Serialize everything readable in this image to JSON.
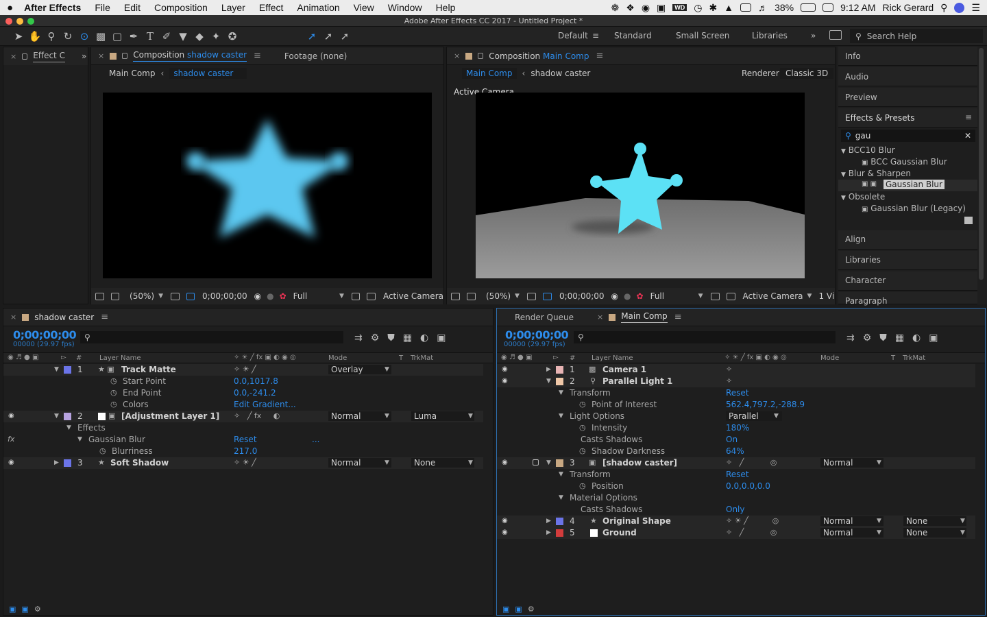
{
  "menubar": {
    "app": "After Effects",
    "items": [
      "File",
      "Edit",
      "Composition",
      "Layer",
      "Effect",
      "Animation",
      "View",
      "Window",
      "Help"
    ],
    "wd_badge": "WD",
    "battery": "38%",
    "time": "9:12 AM",
    "user": "Rick Gerard"
  },
  "window": {
    "title": "Adobe After Effects CC 2017 - Untitled Project *"
  },
  "workspaces": {
    "default": "Default",
    "standard": "Standard",
    "small_screen": "Small Screen",
    "libraries": "Libraries",
    "more": "»",
    "search_placeholder": "Search Help"
  },
  "effect_controls": {
    "tab": "Effect C",
    "more": "»"
  },
  "comp_viewer_left": {
    "tab_prefix": "Composition ",
    "tab_name": "shadow caster",
    "footage_tab": "Footage (none)",
    "breadcrumb": [
      "Main Comp",
      "shadow caster"
    ],
    "zoom": "(50%)",
    "timecode": "0;00;00;00",
    "resolution": "Full",
    "view": "Active Camera"
  },
  "comp_viewer_right": {
    "tab_prefix": "Composition ",
    "tab_name": "Main Comp",
    "breadcrumb": [
      "Main Comp",
      "shadow caster"
    ],
    "renderer_label": "Renderer:",
    "renderer_value": "Classic 3D",
    "canvas_label": "Active Camera",
    "zoom": "(50%)",
    "timecode": "0;00;00;00",
    "resolution": "Full",
    "view": "Active Camera",
    "views_count": "1 Vi"
  },
  "right_panels": {
    "info": "Info",
    "audio": "Audio",
    "preview": "Preview",
    "effects_presets": "Effects & Presets",
    "search_value": "gau",
    "tree": [
      {
        "type": "folder",
        "label": "BCC10 Blur"
      },
      {
        "type": "effect",
        "label": "BCC Gaussian Blur"
      },
      {
        "type": "folder",
        "label": "Blur & Sharpen"
      },
      {
        "type": "effect",
        "label": "Gaussian Blur",
        "selected": true
      },
      {
        "type": "folder",
        "label": "Obsolete"
      },
      {
        "type": "effect",
        "label": "Gaussian Blur (Legacy)"
      }
    ],
    "align": "Align",
    "libraries": "Libraries",
    "character": "Character",
    "paragraph": "Paragraph"
  },
  "timeline_left": {
    "tab": "shadow caster",
    "timecode": "0;00;00;00",
    "fps": "00000 (29.97 fps)",
    "col_num": "#",
    "col_layer_name": "Layer Name",
    "col_mode": "Mode",
    "col_t": "T",
    "col_trkmat": "TrkMat",
    "rows": [
      {
        "kind": "layer",
        "num": "1",
        "name": "Track Matte",
        "mode": "Overlay",
        "color": "#6b74e8"
      },
      {
        "kind": "prop",
        "name": "Start Point",
        "value": "0.0,1017.8"
      },
      {
        "kind": "prop",
        "name": "End Point",
        "value": "0.0,-241.2"
      },
      {
        "kind": "prop",
        "name": "Colors",
        "value": "Edit Gradient..."
      },
      {
        "kind": "layer",
        "num": "2",
        "name": "[Adjustment Layer 1]",
        "mode": "Normal",
        "trkmat": "Luma",
        "color": "#b7a3e0"
      },
      {
        "kind": "group",
        "name": "Effects"
      },
      {
        "kind": "fx",
        "name": "Gaussian Blur",
        "value": "Reset",
        "extra": "..."
      },
      {
        "kind": "prop",
        "name": "Blurriness",
        "value": "217.0"
      },
      {
        "kind": "layer",
        "num": "3",
        "name": "Soft Shadow",
        "mode": "Normal",
        "trkmat": "None",
        "color": "#6b74e8"
      }
    ]
  },
  "timeline_right": {
    "render_queue_tab": "Render Queue",
    "tab": "Main Comp",
    "timecode": "0;00;00;00",
    "fps": "00000 (29.97 fps)",
    "col_num": "#",
    "col_layer_name": "Layer Name",
    "col_mode": "Mode",
    "col_t": "T",
    "col_trkmat": "TrkMat",
    "rows": [
      {
        "kind": "layer",
        "num": "1",
        "name": "Camera 1",
        "color": "#e8b4b4"
      },
      {
        "kind": "layer",
        "num": "2",
        "name": "Parallel Light 1",
        "color": "#f0c8a8"
      },
      {
        "kind": "group",
        "name": "Transform",
        "value": "Reset"
      },
      {
        "kind": "prop",
        "name": "Point of Interest",
        "value": "562.4,797.2,-288.9"
      },
      {
        "kind": "group",
        "name": "Light Options",
        "value": "Parallel"
      },
      {
        "kind": "prop",
        "name": "Intensity",
        "value": "180%"
      },
      {
        "kind": "propn",
        "name": "Casts Shadows",
        "value": "On"
      },
      {
        "kind": "prop",
        "name": "Shadow Darkness",
        "value": "64%"
      },
      {
        "kind": "layer",
        "num": "3",
        "name": "[shadow caster]",
        "mode": "Normal",
        "color": "#c8a882"
      },
      {
        "kind": "group",
        "name": "Transform",
        "value": "Reset"
      },
      {
        "kind": "prop",
        "name": "Position",
        "value": "0.0,0.0,0.0"
      },
      {
        "kind": "group",
        "name": "Material Options"
      },
      {
        "kind": "propn",
        "name": "Casts Shadows",
        "value": "Only"
      },
      {
        "kind": "layer",
        "num": "4",
        "name": "Original Shape",
        "mode": "Normal",
        "trkmat": "None",
        "color": "#6b74e8"
      },
      {
        "kind": "layer",
        "num": "5",
        "name": "Ground",
        "mode": "Normal",
        "trkmat": "None",
        "color": "#d23c3c"
      }
    ]
  },
  "colors": {
    "accent": "#2d8ceb",
    "star": "#5cc7f0",
    "star_3d": "#5ce1f5",
    "ground": "#8a8a8a"
  }
}
